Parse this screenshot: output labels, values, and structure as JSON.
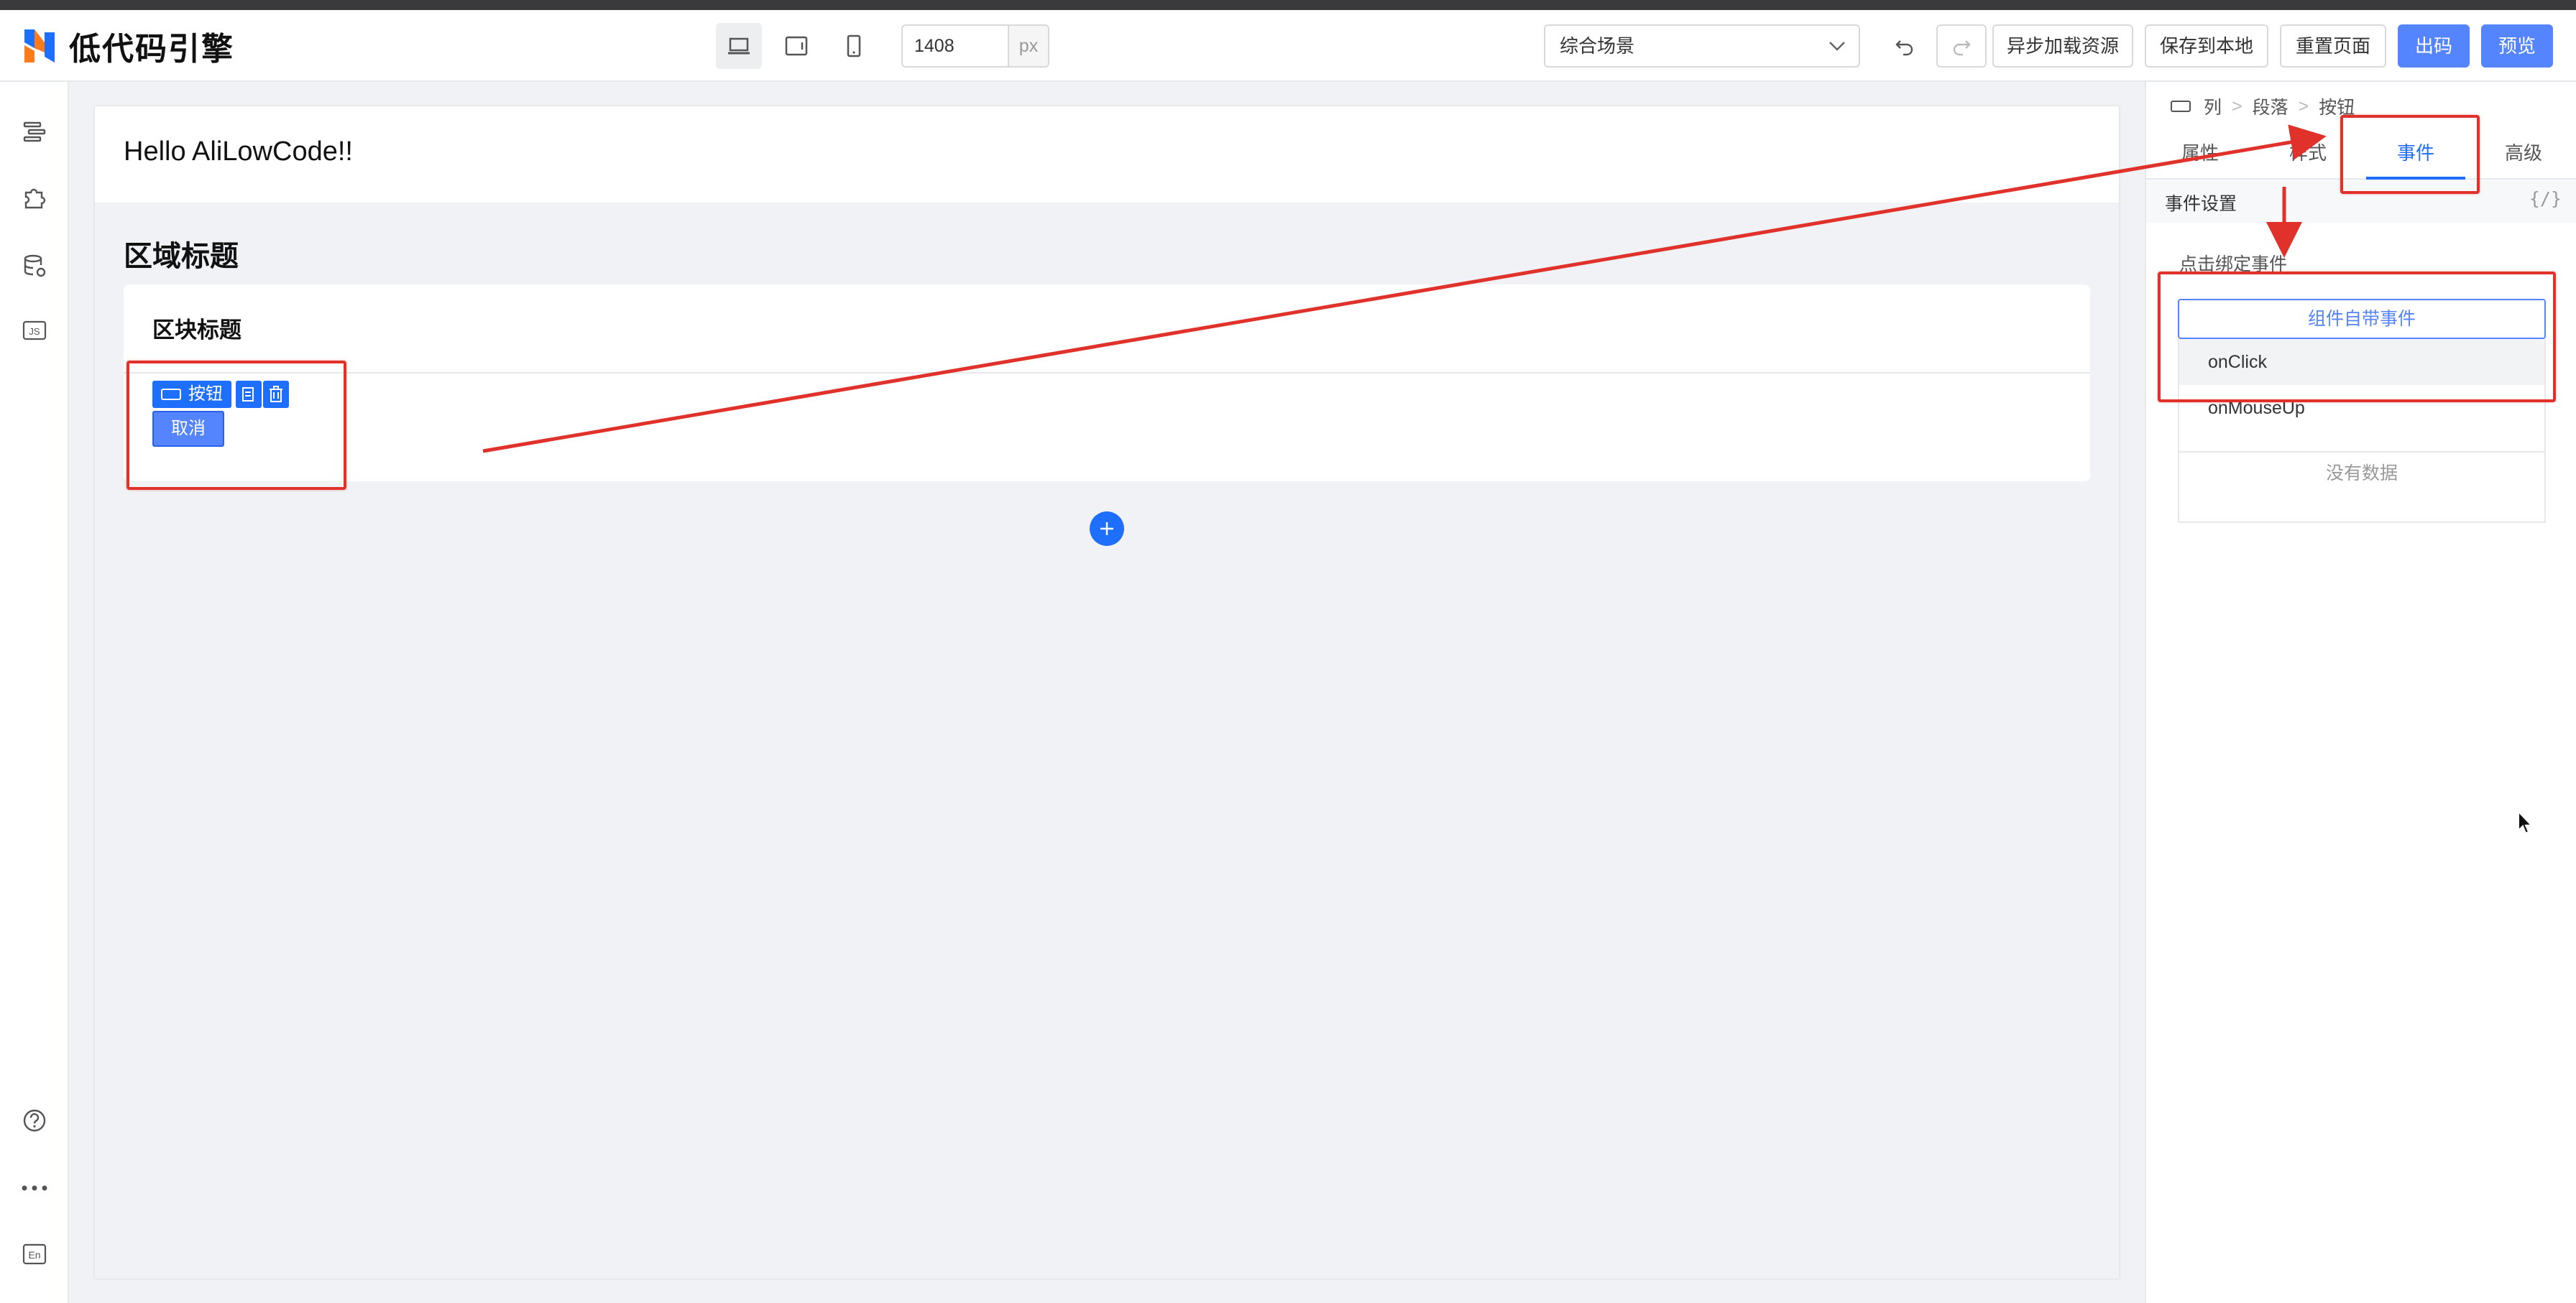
{
  "app": {
    "name": "低代码引擎"
  },
  "toolbar": {
    "width_value": "1408",
    "width_unit": "px",
    "scene": "综合场景",
    "buttons": {
      "async_load": "异步加载资源",
      "save_local": "保存到本地",
      "reset_page": "重置页面",
      "export_code": "出码",
      "preview": "预览"
    }
  },
  "canvas": {
    "header_title": "Hello AliLowCode!!",
    "region_title": "区域标题",
    "block_title": "区块标题",
    "selected_component_tag": "按钮",
    "cancel_button": "取消"
  },
  "right_panel": {
    "breadcrumb": [
      "列",
      "段落",
      "按钮"
    ],
    "tabs": [
      "属性",
      "样式",
      "事件",
      "高级"
    ],
    "active_tab": "事件",
    "section_title": "事件设置",
    "code_toggle": "{/}",
    "bind_label": "点击绑定事件",
    "event_select": "组件自带事件",
    "events": [
      "onClick",
      "onMouseUp"
    ],
    "empty_text": "没有数据"
  },
  "left_sidebar": {
    "lang_badge": "En",
    "js_badge": "JS"
  },
  "colors": {
    "primary": "#5584ff",
    "accent": "#1f6fff",
    "annotation": "#e0322b"
  }
}
